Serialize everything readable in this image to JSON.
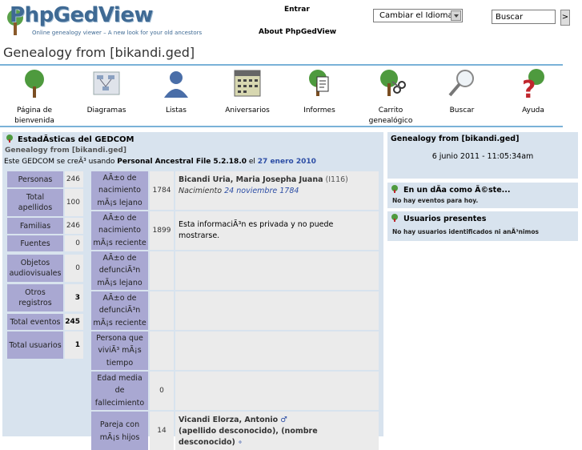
{
  "header": {
    "brand": "PhpGedView",
    "tagline": "Online genealogy viewer – A new look for your old ancestors",
    "login_link": "Entrar",
    "about_link": "About PhpGedView",
    "language_select": "Cambiar el Idioma",
    "search_value": "Buscar",
    "search_go": ">"
  },
  "page_title": "Genealogy from [bikandi.ged]",
  "menu": [
    {
      "label": "Página de bienvenida",
      "icon": "home-tree-icon"
    },
    {
      "label": "Diagramas",
      "icon": "charts-icon"
    },
    {
      "label": "Listas",
      "icon": "lists-person-icon"
    },
    {
      "label": "Aniversarios",
      "icon": "calendar-icon"
    },
    {
      "label": "Informes",
      "icon": "reports-icon"
    },
    {
      "label": "Carrito genealógico",
      "icon": "clippings-cart-icon"
    },
    {
      "label": "Buscar",
      "icon": "magnifier-icon"
    },
    {
      "label": "Ayuda",
      "icon": "help-icon"
    }
  ],
  "stats": {
    "title": "EstadÃsticas del GEDCOM",
    "subtitle": "Genealogy from [bikandi.ged]",
    "created_prefix": "Este GEDCOM se creÃ³ usando",
    "created_software": "Personal Ancestral File 5.2.18.0",
    "created_mid": "el",
    "created_date": "27 enero 2010",
    "counts": [
      {
        "label": "Personas",
        "value": "246"
      },
      {
        "label": "Total apellidos",
        "value": "100"
      },
      {
        "label": "Familias",
        "value": "246"
      },
      {
        "label": "Fuentes",
        "value": "0"
      },
      {
        "label": "Objetos audiovisuales",
        "value": "0"
      },
      {
        "label": "Otros registros",
        "value": "3"
      },
      {
        "label": "Total eventos",
        "value": "245"
      },
      {
        "label": "Total usuarios",
        "value": "1"
      }
    ],
    "records": [
      {
        "label": "AÃ±o de nacimiento mÃ¡s lejano",
        "year": "1784",
        "name": "Bicandi Uria, Maria Josepha Juana",
        "pid": "(I116)",
        "event_prefix": "Nacimiento",
        "event_date": "24 noviembre 1784"
      },
      {
        "label": "AÃ±o de nacimiento mÃ¡s reciente",
        "year": "1899",
        "private": "Esta informaciÃ³n es privada y no puede mostrarse."
      },
      {
        "label": "AÃ±o de defunciÃ³n mÃ¡s lejano",
        "year": ""
      },
      {
        "label": "AÃ±o de defunciÃ³n mÃ¡s reciente",
        "year": ""
      },
      {
        "label": "Persona que viviÃ³ mÃ¡s tiempo",
        "year": ""
      },
      {
        "label": "Edad media de fallecimiento",
        "year": "0"
      },
      {
        "label": "Pareja con mÃ¡s hijos",
        "year": "14",
        "name": "Vicandi Elorza, Antonio",
        "name2": "(apellido desconocido), (nombre desconocido)"
      }
    ]
  },
  "sidebar": {
    "gedcom_title": "Genealogy from [bikandi.ged]",
    "gedcom_datetime": "6 junio 2011 - 11:05:34am",
    "onthisday_title": "En un dÃa como Ã©ste...",
    "onthisday_body": "No hay eventos para hoy.",
    "users_title": "Usuarios presentes",
    "users_body": "No hay usuarios identificados ni anÃ³nimos"
  }
}
